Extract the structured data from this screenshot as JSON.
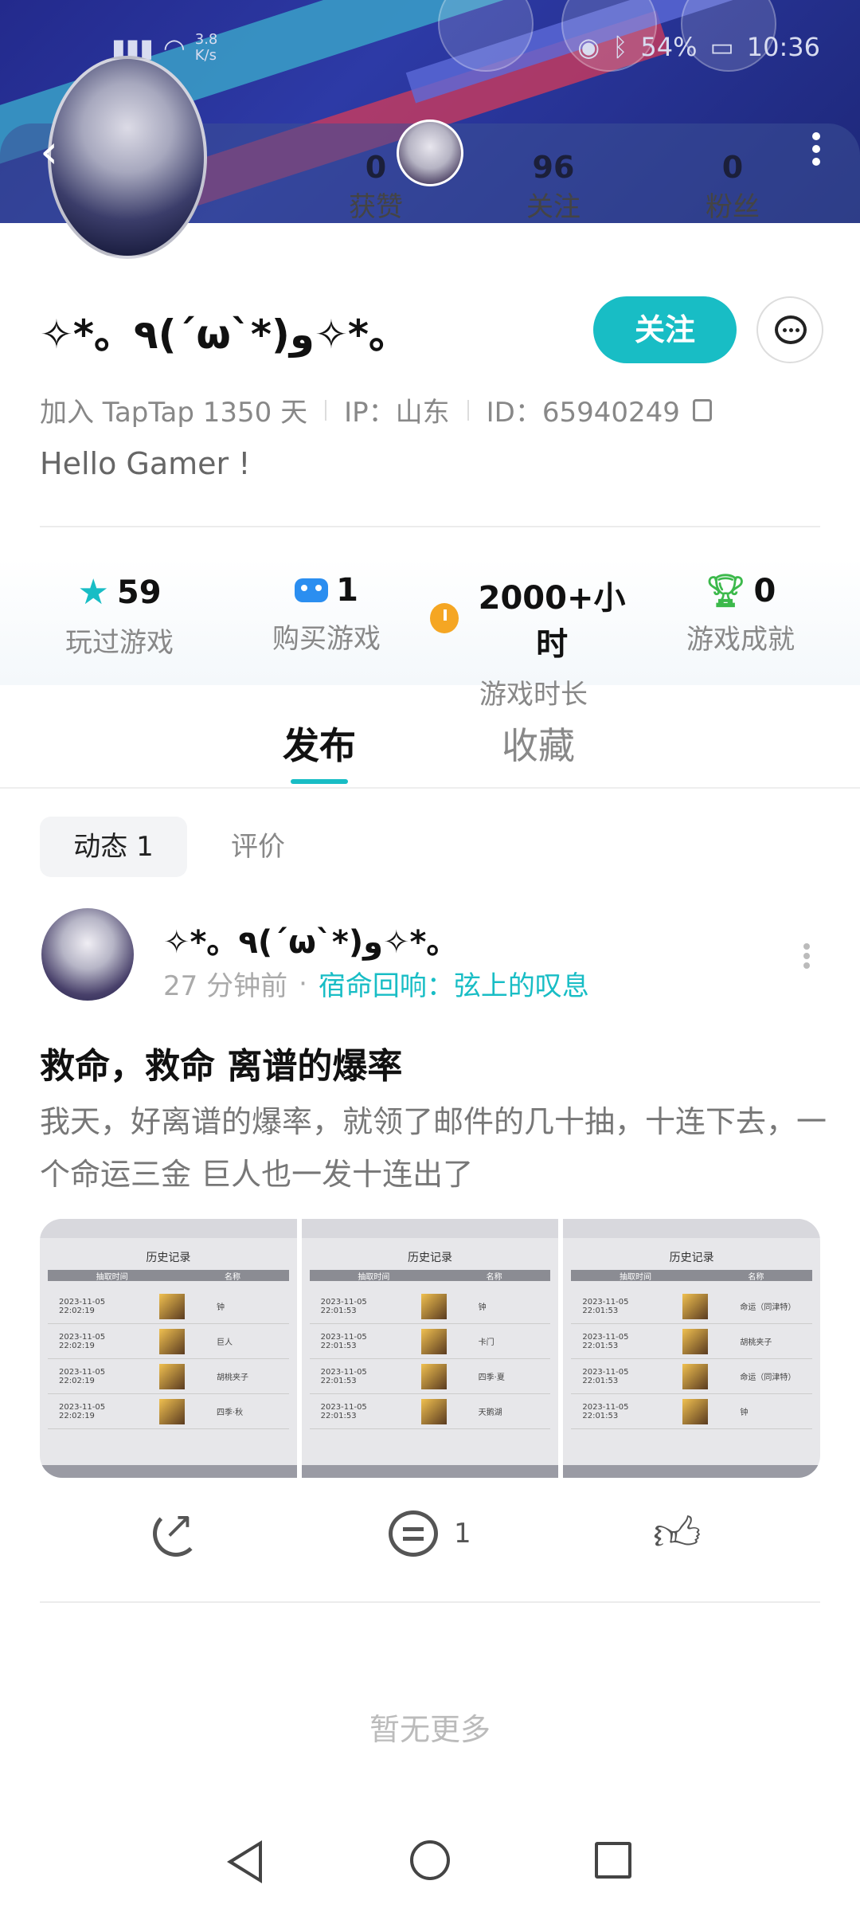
{
  "status_bar": {
    "network_speed": "3.8 K/s",
    "battery": "54%",
    "time": "10:36"
  },
  "header": {
    "stats": [
      {
        "value": "0",
        "label": "获赞"
      },
      {
        "value": "96",
        "label": "关注"
      },
      {
        "value": "0",
        "label": "粉丝"
      }
    ]
  },
  "profile": {
    "username": "✧*。٩(ˊωˋ*)و✧*。",
    "follow_label": "关注",
    "joined": "加入 TapTap 1350 天",
    "ip": "IP：山东",
    "id": "ID：65940249",
    "bio": "Hello Gamer !"
  },
  "game_stats": [
    {
      "icon": "star-icon",
      "value": "59",
      "label": "玩过游戏"
    },
    {
      "icon": "gamepad-icon",
      "value": "1",
      "label": "购买游戏"
    },
    {
      "icon": "timer-icon",
      "value": "2000+小时",
      "label": "游戏时长"
    },
    {
      "icon": "trophy-icon",
      "value": "0",
      "label": "游戏成就"
    }
  ],
  "tabs": [
    {
      "label": "发布",
      "active": true
    },
    {
      "label": "收藏",
      "active": false
    }
  ],
  "subtabs": [
    {
      "label": "动态 1",
      "active": true
    },
    {
      "label": "评价",
      "active": false
    }
  ],
  "post": {
    "author": "✧*。٩(ˊωˋ*)و✧*。",
    "time": "27 分钟前",
    "game": "宿命回响：弦上的叹息",
    "title": "救命，救命 离谱的爆率",
    "body": "我天，好离谱的爆率，就领了邮件的几十抽，十连下去，一个命运三金 巨人也一发十连出了",
    "images": [
      {
        "heading": "历史记录",
        "columns": [
          "抽取时间",
          "名称"
        ],
        "rows": [
          {
            "time": "2023-11-05 22:02:19",
            "name": "钟"
          },
          {
            "time": "2023-11-05 22:02:19",
            "name": "巨人"
          },
          {
            "time": "2023-11-05 22:02:19",
            "name": "胡桃夹子"
          },
          {
            "time": "2023-11-05 22:02:19",
            "name": "四季·秋"
          }
        ]
      },
      {
        "heading": "历史记录",
        "columns": [
          "抽取时间",
          "名称"
        ],
        "rows": [
          {
            "time": "2023-11-05 22:01:53",
            "name": "钟"
          },
          {
            "time": "2023-11-05 22:01:53",
            "name": "卡门"
          },
          {
            "time": "2023-11-05 22:01:53",
            "name": "四季·夏"
          },
          {
            "time": "2023-11-05 22:01:53",
            "name": "天鹅湖"
          }
        ]
      },
      {
        "heading": "历史记录",
        "columns": [
          "抽取时间",
          "名称"
        ],
        "rows": [
          {
            "time": "2023-11-05 22:01:53",
            "name": "命运（同津特）"
          },
          {
            "time": "2023-11-05 22:01:53",
            "name": "胡桃夹子"
          },
          {
            "time": "2023-11-05 22:01:53",
            "name": "命运（同津特）"
          },
          {
            "time": "2023-11-05 22:01:53",
            "name": "钟"
          }
        ]
      }
    ],
    "comment_count": "1"
  },
  "footer": {
    "no_more": "暂无更多"
  }
}
